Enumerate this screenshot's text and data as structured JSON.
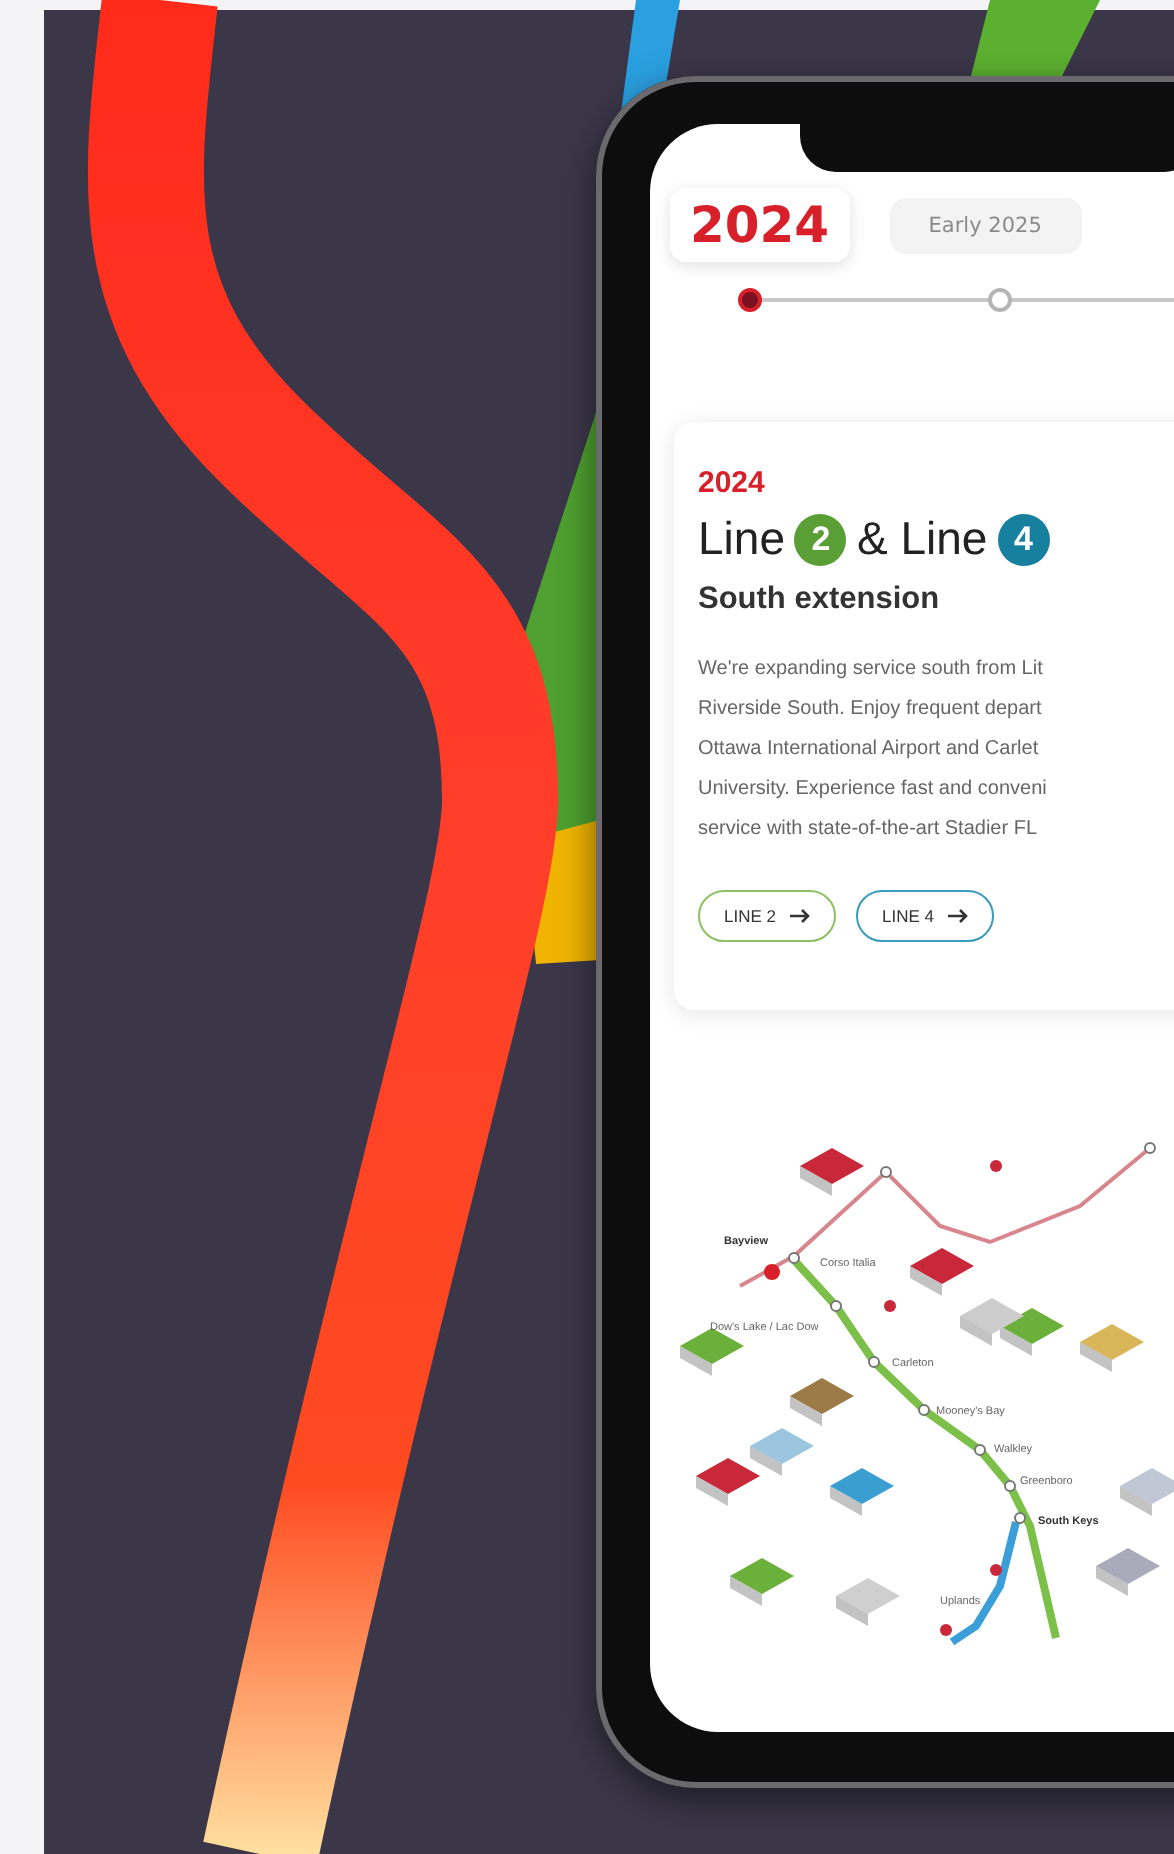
{
  "tabs": [
    {
      "label": "2024",
      "selected": true
    },
    {
      "label": "Early 2025",
      "selected": false
    }
  ],
  "card": {
    "year": "2024",
    "title": [
      {
        "kind": "text",
        "text": "Line"
      },
      {
        "kind": "badge",
        "text": "2",
        "color": "#5a9f35"
      },
      {
        "kind": "text",
        "text": "& Line"
      },
      {
        "kind": "badge",
        "text": "4",
        "color": "#17809e"
      }
    ],
    "subtitle": "South extension",
    "description": "We're expanding service south from Lit\nRiverside South. Enjoy frequent depart\nOttawa International Airport and Carlet\nUniversity. Experience fast and conveni\nservice with state-of-the-art Stadier FL",
    "buttons": [
      {
        "label": "LINE 2",
        "color": "#8cc063"
      },
      {
        "label": "LINE 4",
        "color": "#3b9bbb"
      }
    ]
  },
  "map": {
    "stations": [
      "Bayview",
      "Corso Italia",
      "Dow's Lake / Lac Dow",
      "Carleton",
      "Mooney's Bay",
      "Walkley",
      "Greenboro",
      "South Keys",
      "Uplands"
    ]
  }
}
